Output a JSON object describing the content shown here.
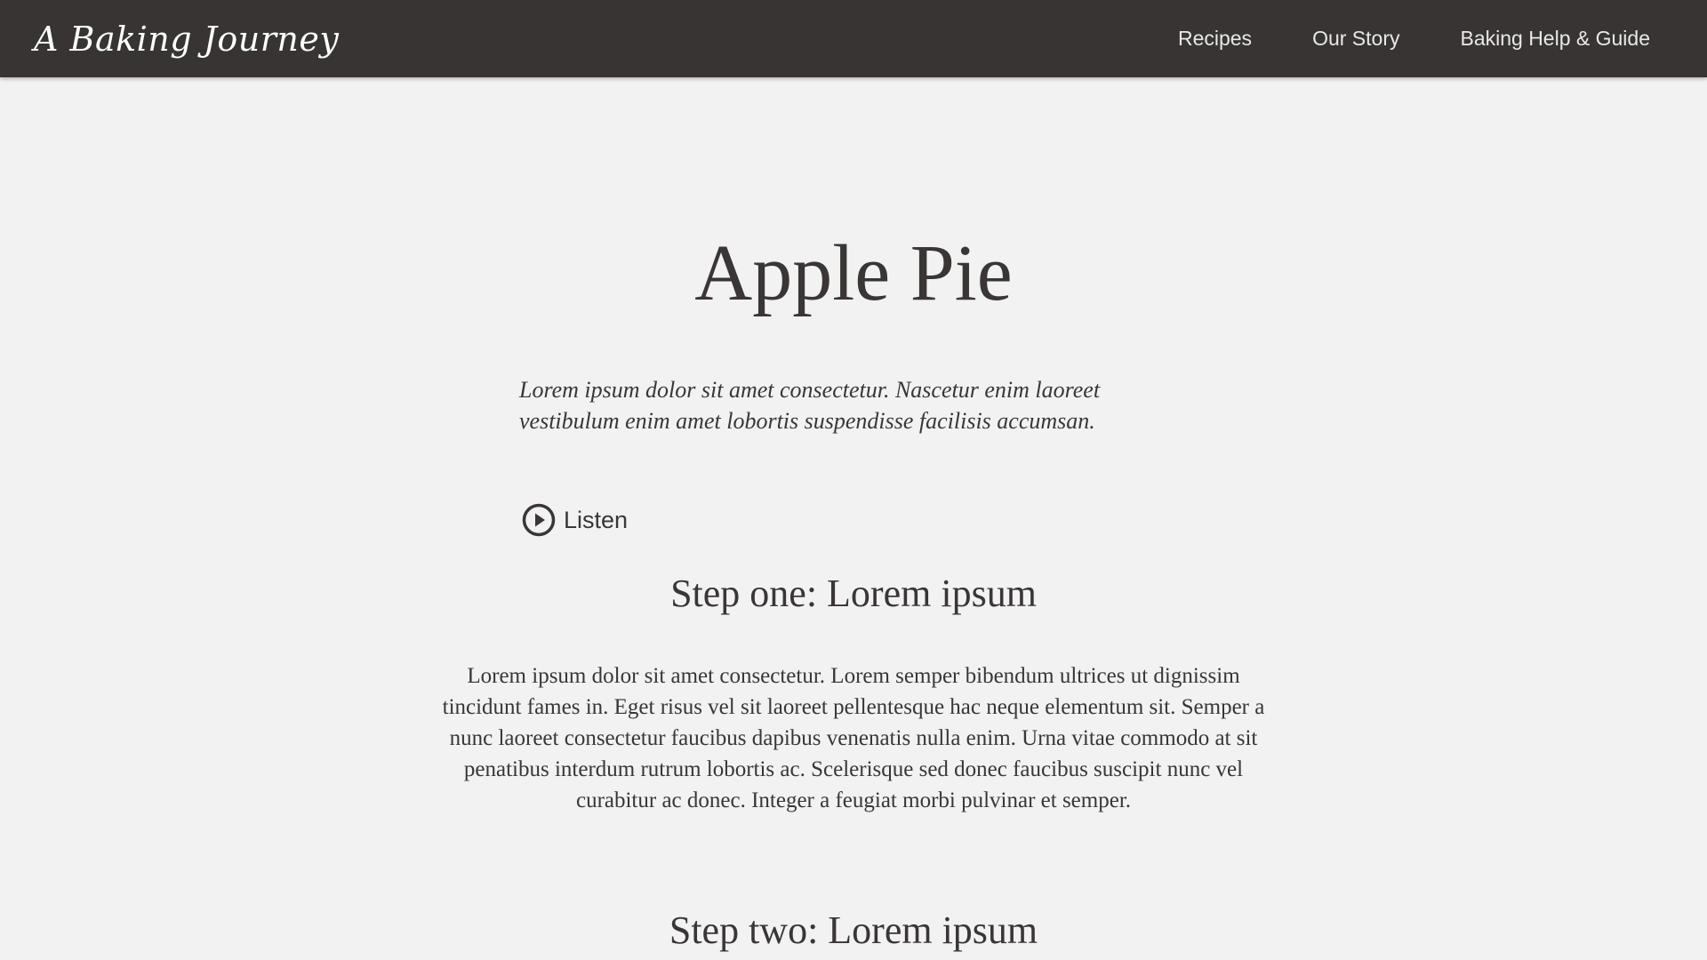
{
  "header": {
    "brand": "A Baking Journey",
    "nav": [
      {
        "label": "Recipes"
      },
      {
        "label": "Our Story"
      },
      {
        "label": "Baking Help & Guide"
      }
    ]
  },
  "main": {
    "title": "Apple Pie",
    "intro": "Lorem ipsum dolor sit amet consectetur. Nascetur enim laoreet vestibulum enim amet lobortis suspendisse facilisis accumsan.",
    "listen": {
      "label": "Listen",
      "icon": "play-circle-icon"
    },
    "steps": [
      {
        "heading": "Step one: Lorem ipsum",
        "body": "Lorem ipsum dolor sit amet consectetur. Lorem semper bibendum ultrices ut dignissim tincidunt fames in. Eget risus vel sit laoreet pellentesque hac neque elementum sit. Semper a nunc laoreet consectetur faucibus dapibus venenatis nulla enim. Urna vitae commodo at sit penatibus interdum rutrum lobortis ac. Scelerisque sed donec faucibus suscipit nunc vel curabitur ac donec. Integer a feugiat morbi pulvinar et semper."
      },
      {
        "heading": "Step two: Lorem ipsum"
      }
    ]
  },
  "colors": {
    "header_bg": "#383434",
    "page_bg": "#f2f2f2",
    "text": "#3a3636"
  }
}
